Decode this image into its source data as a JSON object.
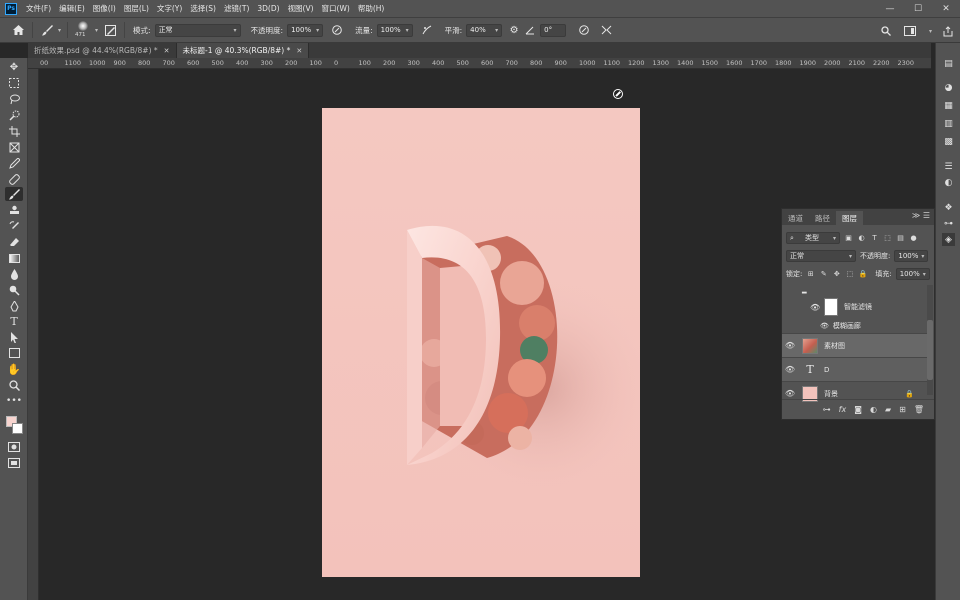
{
  "app": {
    "logo": "Ps"
  },
  "menu": [
    "文件(F)",
    "编辑(E)",
    "图像(I)",
    "图层(L)",
    "文字(Y)",
    "选择(S)",
    "滤镜(T)",
    "3D(D)",
    "视图(V)",
    "窗口(W)",
    "帮助(H)"
  ],
  "window_controls": {
    "minimize": "—",
    "maximize": "☐",
    "close": "✕"
  },
  "options": {
    "brush_size": "471",
    "mode_label": "模式:",
    "mode_value": "正常",
    "opacity_label": "不透明度:",
    "opacity_value": "100%",
    "flow_label": "流量:",
    "flow_value": "100%",
    "smoothing_label": "平滑:",
    "smoothing_value": "40%",
    "angle_value": "0°"
  },
  "tabs": [
    {
      "label": "折纸效果.psd @ 44.4%(RGB/8#) *",
      "close": "✕"
    },
    {
      "label": "未标题-1 @ 40.3%(RGB/8#) *",
      "close": "✕"
    }
  ],
  "ruler_labels": [
    "00",
    "1100",
    "1000",
    "900",
    "800",
    "700",
    "600",
    "500",
    "400",
    "300",
    "200",
    "100",
    "0",
    "100",
    "200",
    "300",
    "400",
    "500",
    "600",
    "700",
    "800",
    "900",
    "1000",
    "1100",
    "1200",
    "1300",
    "1400",
    "1500",
    "1600",
    "1700",
    "1800",
    "1900",
    "2000",
    "2100",
    "2200",
    "2300"
  ],
  "layers_panel": {
    "tabs": [
      "通道",
      "路径",
      "图层"
    ],
    "kind_label": "类型",
    "blend_mode": "正常",
    "opacity_label": "不透明度:",
    "opacity_value": "100%",
    "lock_label": "锁定:",
    "fill_label": "填充:",
    "fill_value": "100%",
    "smart_filters_label": "智能滤镜",
    "filter_name": "模糊画廊",
    "layers": [
      {
        "name": "素材图",
        "selected": true
      },
      {
        "name": "D",
        "type": "text"
      },
      {
        "name": "背景",
        "locked": true
      }
    ]
  },
  "colors": {
    "foreground": "#f7d4cf",
    "background": "#ffffff",
    "canvas": "#f3c3bc",
    "workspace": "#282828",
    "panel": "#535353"
  }
}
